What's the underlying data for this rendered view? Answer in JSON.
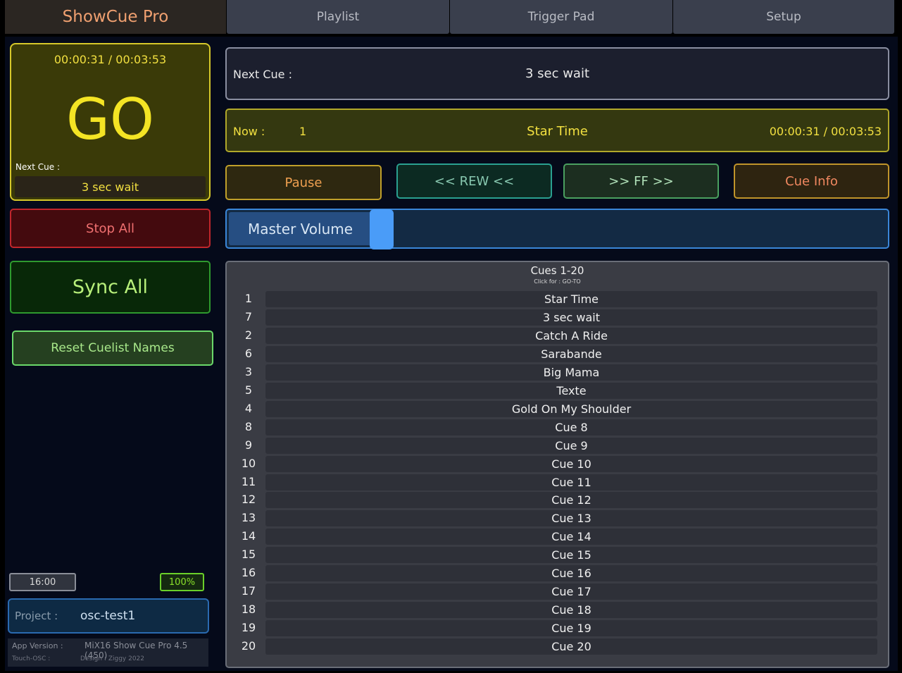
{
  "header": {
    "app_title": "ShowCue Pro",
    "tabs": [
      {
        "label": "Playlist"
      },
      {
        "label": "Trigger Pad"
      },
      {
        "label": "Setup"
      }
    ]
  },
  "go_panel": {
    "time": "00:00:31 / 00:03:53",
    "go_label": "GO",
    "next_cue_label": "Next Cue :",
    "next_cue_name": "3 sec wait",
    "color": "#f4e424"
  },
  "left_buttons": {
    "stop_all": "Stop All",
    "sync_all": "Sync All",
    "reset_cuelist": "Reset Cuelist Names"
  },
  "status": {
    "clock": "16:00",
    "battery": "100%"
  },
  "project": {
    "label": "Project :",
    "name": "osc-test1"
  },
  "version": {
    "label": "App Version   :",
    "value": "MiX16 Show Cue Pro 4.5 (450)",
    "platform": "Touch-OSC :",
    "design": "Design : Ziggy 2022"
  },
  "next_cue": {
    "label": "Next Cue :",
    "name": "3 sec wait"
  },
  "now": {
    "label": "Now :",
    "number": "1",
    "name": "Star Time",
    "time": "00:00:31 / 00:03:53"
  },
  "transport": {
    "pause": "Pause",
    "rew": "<< REW <<",
    "ff": ">>  FF  >>",
    "cue_info": "Cue Info"
  },
  "volume": {
    "label": "Master Volume",
    "level": 0.22
  },
  "cuelist": {
    "title": "Cues  1-20",
    "subtitle": "Click for : GO-TO",
    "rows": [
      {
        "num": "1",
        "name": "Star Time"
      },
      {
        "num": "7",
        "name": "3 sec wait"
      },
      {
        "num": "2",
        "name": "Catch A Ride"
      },
      {
        "num": "6",
        "name": "Sarabande"
      },
      {
        "num": "3",
        "name": "Big Mama"
      },
      {
        "num": "5",
        "name": "Texte"
      },
      {
        "num": "4",
        "name": "Gold On My Shoulder"
      },
      {
        "num": "8",
        "name": "Cue 8"
      },
      {
        "num": "9",
        "name": "Cue 9"
      },
      {
        "num": "10",
        "name": "Cue 10"
      },
      {
        "num": "11",
        "name": "Cue 11"
      },
      {
        "num": "12",
        "name": "Cue 12"
      },
      {
        "num": "13",
        "name": "Cue 13"
      },
      {
        "num": "14",
        "name": "Cue 14"
      },
      {
        "num": "15",
        "name": "Cue 15"
      },
      {
        "num": "16",
        "name": "Cue 16"
      },
      {
        "num": "17",
        "name": "Cue 17"
      },
      {
        "num": "18",
        "name": "Cue 18"
      },
      {
        "num": "19",
        "name": "Cue 19"
      },
      {
        "num": "20",
        "name": "Cue 20"
      }
    ]
  }
}
